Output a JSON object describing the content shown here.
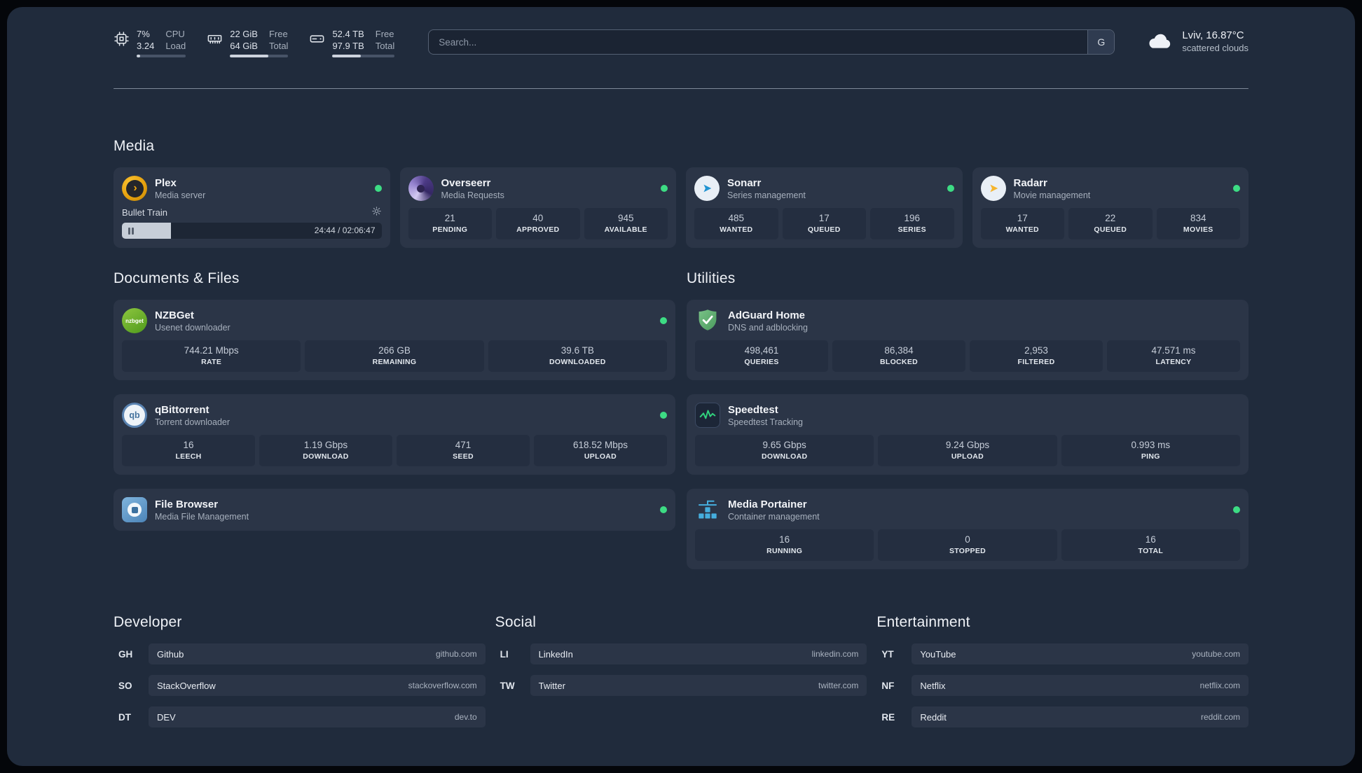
{
  "palette": {
    "background": "#202b3c",
    "card": "#2b3547",
    "tile": "#242e40",
    "status_online": "#3ddc84"
  },
  "topbar": {
    "cpu": {
      "icon": "cpu-chip-icon",
      "value_primary": "7%",
      "value_secondary": "3.24",
      "label_primary": "CPU",
      "label_secondary": "Load",
      "percent_used": 7
    },
    "memory": {
      "icon": "memory-icon",
      "value_primary": "22 GiB",
      "value_secondary": "64 GiB",
      "label_primary": "Free",
      "label_secondary": "Total",
      "percent_used": 66
    },
    "disk": {
      "icon": "hard-disk-icon",
      "value_primary": "52.4 TB",
      "value_secondary": "97.9 TB",
      "label_primary": "Free",
      "label_secondary": "Total",
      "percent_used": 46
    },
    "search": {
      "placeholder": "Search...",
      "provider_button": "G"
    },
    "weather": {
      "icon": "cloud-icon",
      "location": "Lviv, 16.87°C",
      "condition": "scattered clouds"
    }
  },
  "media": {
    "title": "Media",
    "plex": {
      "name": "Plex",
      "subtitle": "Media server",
      "icon": "plex-icon",
      "icon_glyph": "›",
      "now_playing": "Bullet Train",
      "time": "24:44 / 02:06:47",
      "progress_percent": 19
    },
    "overseerr": {
      "name": "Overseerr",
      "subtitle": "Media Requests",
      "icon": "overseerr-icon",
      "stats": [
        {
          "value": "21",
          "label": "PENDING"
        },
        {
          "value": "40",
          "label": "APPROVED"
        },
        {
          "value": "945",
          "label": "AVAILABLE"
        }
      ]
    },
    "sonarr": {
      "name": "Sonarr",
      "subtitle": "Series management",
      "icon": "sonarr-icon",
      "stats": [
        {
          "value": "485",
          "label": "WANTED"
        },
        {
          "value": "17",
          "label": "QUEUED"
        },
        {
          "value": "196",
          "label": "SERIES"
        }
      ]
    },
    "radarr": {
      "name": "Radarr",
      "subtitle": "Movie management",
      "icon": "radarr-icon",
      "stats": [
        {
          "value": "17",
          "label": "WANTED"
        },
        {
          "value": "22",
          "label": "QUEUED"
        },
        {
          "value": "834",
          "label": "MOVIES"
        }
      ]
    }
  },
  "documents": {
    "title": "Documents & Files",
    "nzbget": {
      "name": "NZBGet",
      "subtitle": "Usenet downloader",
      "icon": "nzbget-icon",
      "icon_label": "nzbget",
      "stats": [
        {
          "value": "744.21 Mbps",
          "label": "RATE"
        },
        {
          "value": "266 GB",
          "label": "REMAINING"
        },
        {
          "value": "39.6 TB",
          "label": "DOWNLOADED"
        }
      ]
    },
    "qbittorrent": {
      "name": "qBittorrent",
      "subtitle": "Torrent downloader",
      "icon": "qbittorrent-icon",
      "icon_label": "qb",
      "stats": [
        {
          "value": "16",
          "label": "LEECH"
        },
        {
          "value": "1.19 Gbps",
          "label": "DOWNLOAD"
        },
        {
          "value": "471",
          "label": "SEED"
        },
        {
          "value": "618.52 Mbps",
          "label": "UPLOAD"
        }
      ]
    },
    "filebrowser": {
      "name": "File Browser",
      "subtitle": "Media File Management",
      "icon": "filebrowser-icon"
    }
  },
  "utilities": {
    "title": "Utilities",
    "adguard": {
      "name": "AdGuard Home",
      "subtitle": "DNS and adblocking",
      "icon": "adguard-shield-icon",
      "stats": [
        {
          "value": "498,461",
          "label": "QUERIES"
        },
        {
          "value": "86,384",
          "label": "BLOCKED"
        },
        {
          "value": "2,953",
          "label": "FILTERED"
        },
        {
          "value": "47.571 ms",
          "label": "LATENCY"
        }
      ]
    },
    "speedtest": {
      "name": "Speedtest",
      "subtitle": "Speedtest Tracking",
      "icon": "speedtest-icon",
      "stats": [
        {
          "value": "9.65 Gbps",
          "label": "DOWNLOAD"
        },
        {
          "value": "9.24 Gbps",
          "label": "UPLOAD"
        },
        {
          "value": "0.993 ms",
          "label": "PING"
        }
      ]
    },
    "portainer": {
      "name": "Media Portainer",
      "subtitle": "Container management",
      "icon": "portainer-crane-icon",
      "stats": [
        {
          "value": "16",
          "label": "RUNNING"
        },
        {
          "value": "0",
          "label": "STOPPED"
        },
        {
          "value": "16",
          "label": "TOTAL"
        }
      ]
    }
  },
  "bookmarks": {
    "developer": {
      "title": "Developer",
      "items": [
        {
          "abbr": "GH",
          "name": "Github",
          "url": "github.com"
        },
        {
          "abbr": "SO",
          "name": "StackOverflow",
          "url": "stackoverflow.com"
        },
        {
          "abbr": "DT",
          "name": "DEV",
          "url": "dev.to"
        }
      ]
    },
    "social": {
      "title": "Social",
      "items": [
        {
          "abbr": "LI",
          "name": "LinkedIn",
          "url": "linkedin.com"
        },
        {
          "abbr": "TW",
          "name": "Twitter",
          "url": "twitter.com"
        }
      ]
    },
    "entertainment": {
      "title": "Entertainment",
      "items": [
        {
          "abbr": "YT",
          "name": "YouTube",
          "url": "youtube.com"
        },
        {
          "abbr": "NF",
          "name": "Netflix",
          "url": "netflix.com"
        },
        {
          "abbr": "RE",
          "name": "Reddit",
          "url": "reddit.com"
        }
      ]
    }
  }
}
